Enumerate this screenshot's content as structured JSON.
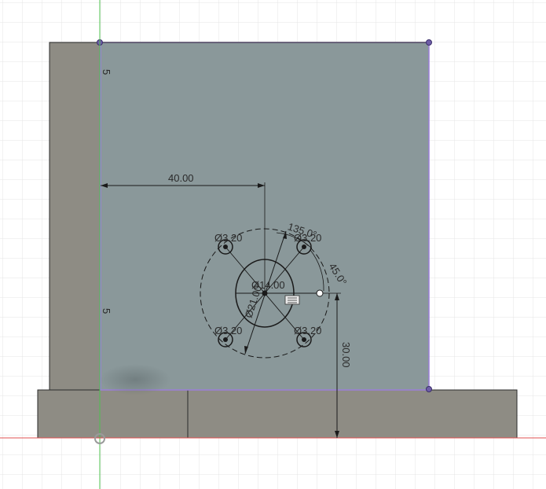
{
  "viewport": {
    "background": "#ffffff",
    "grid_color": "#e3e3e3",
    "x_axis_color": "#e05050",
    "y_axis_color": "#4fc04f",
    "body_color": "#8e8c84",
    "sketch_face_color": "#8a989a",
    "sketch_edge_color": "#9b7fd9"
  },
  "dimensions": {
    "horizontal_offset": "40.00",
    "vertical_offset": "30.00",
    "angle_top": "135.0°",
    "angle_right": "45.0°",
    "center_hole_dia": "Ø14.00",
    "bolt_circle_dia": "Ø21.00",
    "hole_top_left": "Ø3.20",
    "hole_top_right": "Ø3.20",
    "hole_bottom_left": "Ø3.20",
    "hole_bottom_right": "Ø3.20",
    "edge_dim_top": "5",
    "edge_dim_bottom": "5"
  }
}
